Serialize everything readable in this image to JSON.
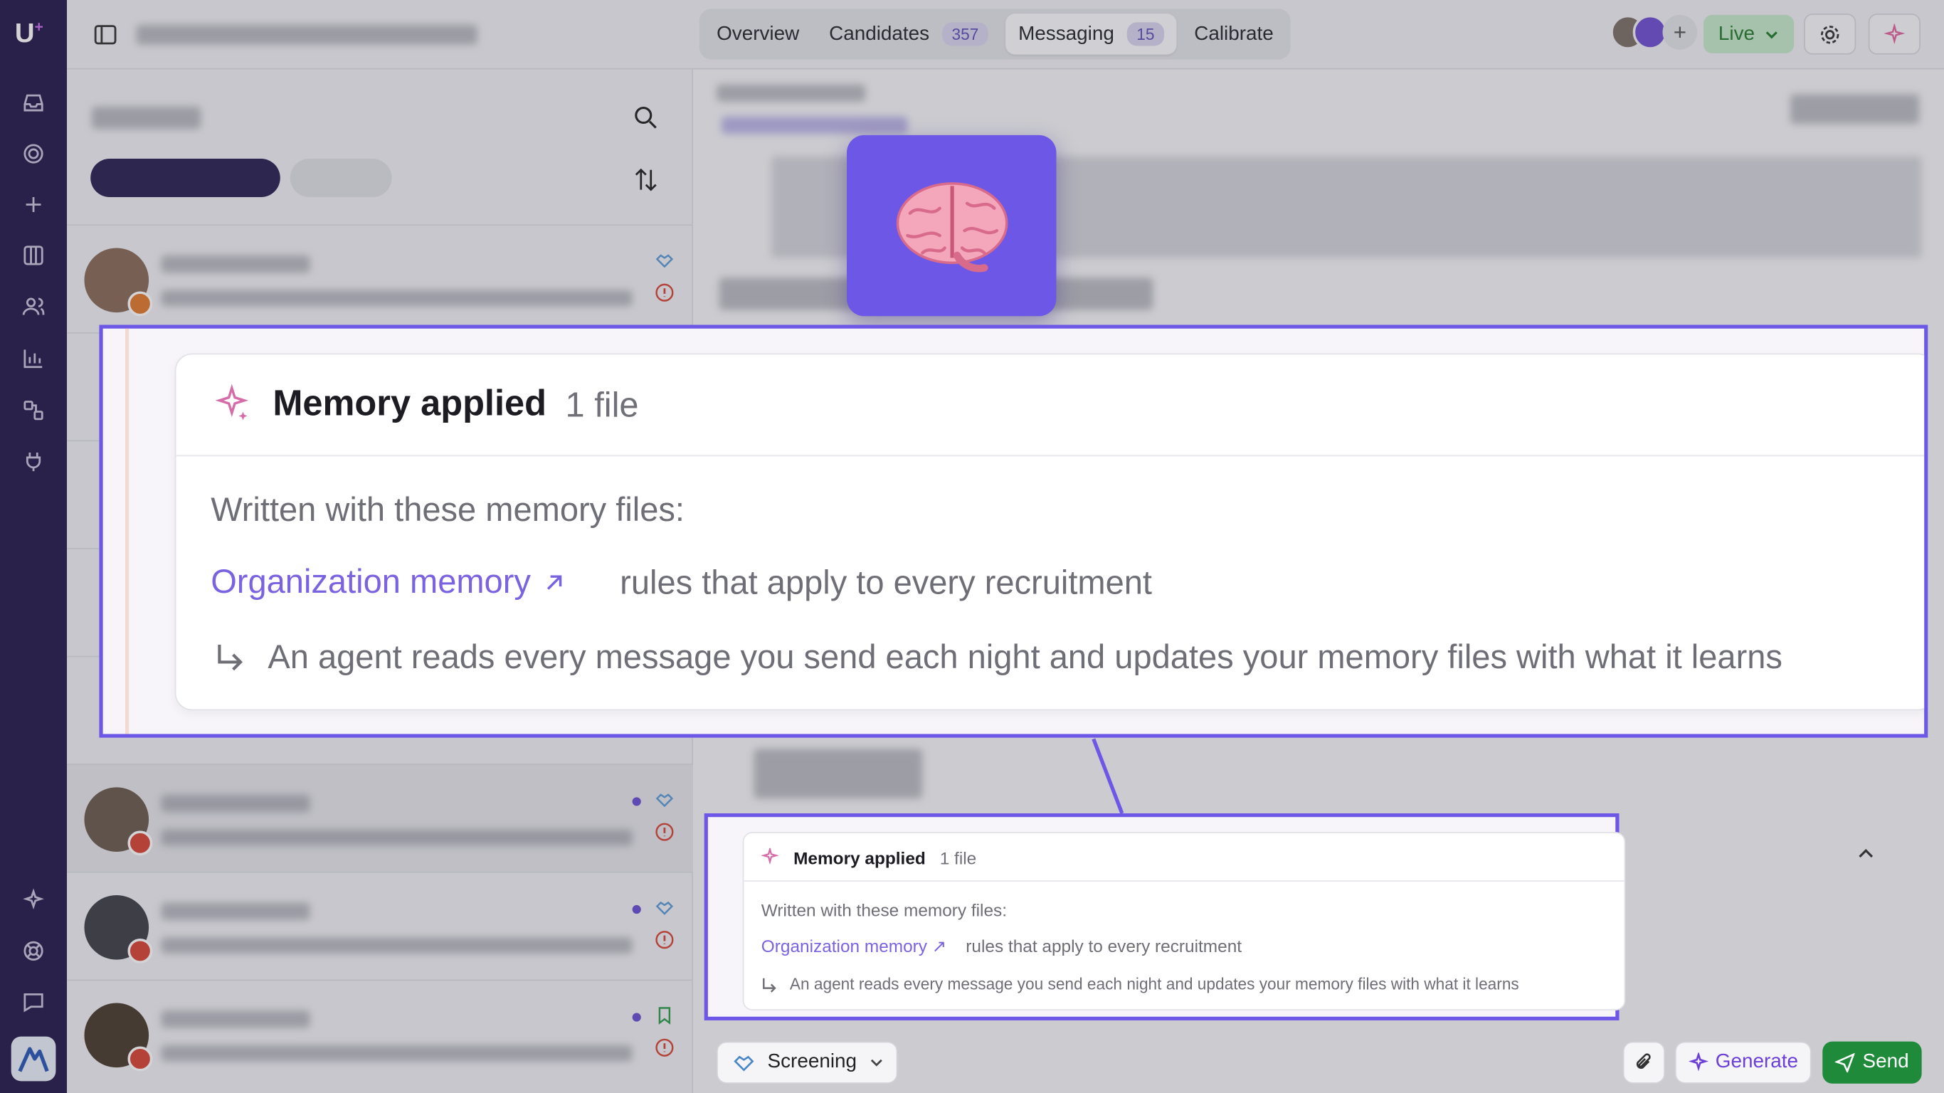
{
  "topbar": {
    "tabs": [
      {
        "label": "Overview",
        "count": ""
      },
      {
        "label": "Candidates",
        "count": "357"
      },
      {
        "label": "Messaging",
        "count": "15"
      },
      {
        "label": "Calibrate",
        "count": ""
      }
    ],
    "live_label": "Live"
  },
  "memory_zoom": {
    "title": "Memory applied",
    "count": "1 file",
    "lead": "Written with these memory files:",
    "link": "Organization memory",
    "link_desc": "rules that apply to every recruitment",
    "note": "An agent reads every message you send each night and updates your memory files with what it learns"
  },
  "memory_panel": {
    "title": "Memory applied",
    "count": "1 file",
    "lead": "Written with these memory files:",
    "link": "Organization memory ↗",
    "link_desc": "rules that apply to every recruitment",
    "note": "An agent reads every message you send each night and updates your memory files with what it learns"
  },
  "composer": {
    "stage_label": "Screening",
    "generate_label": "Generate",
    "send_label": "Send"
  },
  "colors": {
    "accent": "#6d57e6",
    "rail": "#251a4a",
    "send": "#1f8a3a",
    "live_bg": "#c5e8c8"
  },
  "icons": {
    "brain": "brain-emoji"
  }
}
